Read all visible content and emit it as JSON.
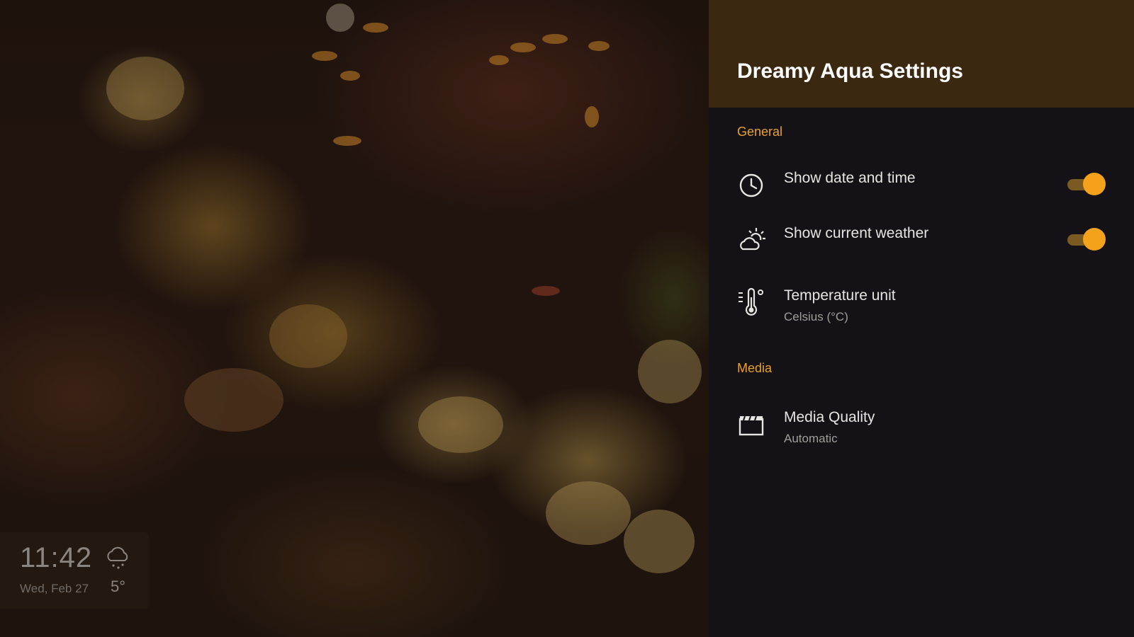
{
  "background": {
    "clock_widget": {
      "time": "11:42",
      "date": "Wed, Feb 27",
      "temperature": "5°",
      "weather_icon": "cloud-snow-icon"
    }
  },
  "settings": {
    "title": "Dreamy Aqua Settings",
    "sections": {
      "general": {
        "label": "General",
        "items": {
          "date_time": {
            "label": "Show date and time",
            "icon": "clock-icon",
            "enabled": true
          },
          "weather": {
            "label": "Show current weather",
            "icon": "weather-icon",
            "enabled": true
          },
          "temperature_unit": {
            "label": "Temperature unit",
            "value": "Celsius (°C)",
            "icon": "thermometer-icon"
          }
        }
      },
      "media": {
        "label": "Media",
        "items": {
          "quality": {
            "label": "Media Quality",
            "value": "Automatic",
            "icon": "clapperboard-icon"
          }
        }
      }
    }
  },
  "colors": {
    "accent": "#f4a21c",
    "header_bg": "#3b2810",
    "panel_bg": "#141216",
    "section_label": "#e8a12a"
  }
}
